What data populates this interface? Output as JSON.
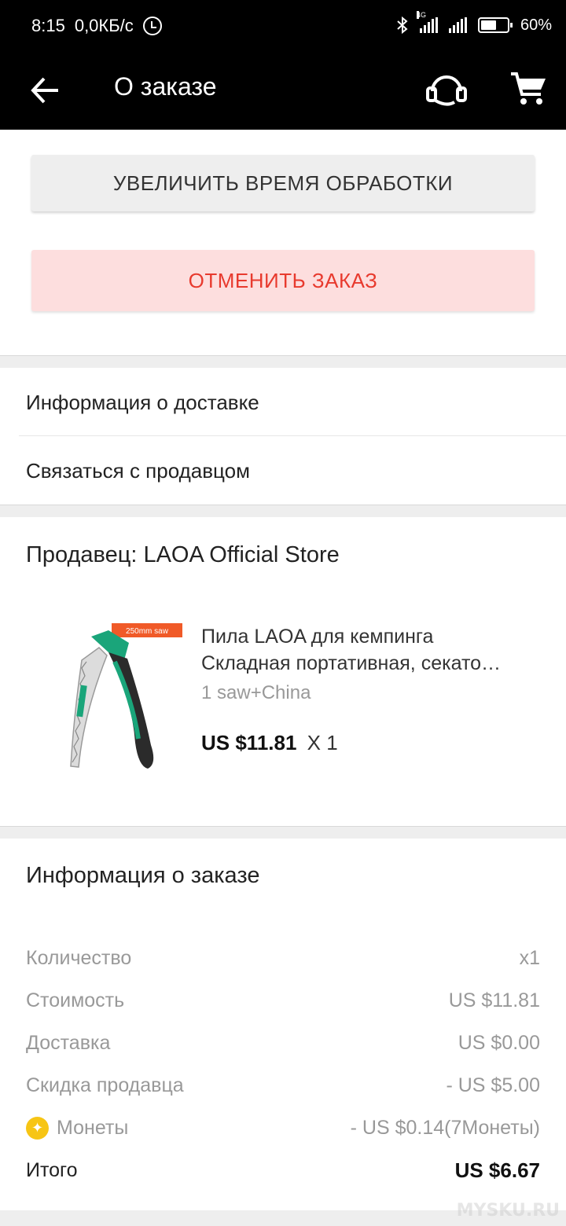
{
  "status_bar": {
    "time": "8:15",
    "speed": "0,0КБ/с",
    "network": "4G",
    "battery": "60%",
    "battery_level": 0.6
  },
  "header": {
    "title": "О заказе"
  },
  "actions": {
    "extend_label": "УВЕЛИЧИТЬ ВРЕМЯ ОБРАБОТКИ",
    "cancel_label": "ОТМЕНИТЬ ЗАКАЗ"
  },
  "menu": {
    "shipping_info": "Информация о доставке",
    "contact_seller": "Связаться с продавцом"
  },
  "seller": {
    "label": "Продавец: LAOA Official Store"
  },
  "product": {
    "badge": "250mm saw",
    "title_line1": "Пила LAOA для кемпинга",
    "title_line2": "Складная портативная, секато…",
    "variant": "1 saw+China",
    "price": "US $11.81",
    "qty": "X 1"
  },
  "order_info": {
    "title": "Информация о заказе",
    "rows": [
      {
        "label": "Количество",
        "value": "x1"
      },
      {
        "label": "Стоимость",
        "value": "US $11.81"
      },
      {
        "label": "Доставка",
        "value": "US $0.00"
      },
      {
        "label": "Скидка продавца",
        "value": "- US $5.00"
      },
      {
        "label": "Монеты",
        "value": "- US $0.14(7Монеты)"
      },
      {
        "label": "Итого",
        "value": "US $6.67"
      }
    ]
  },
  "watermark": "MYSKU.RU",
  "colors": {
    "header_bg": "#000000",
    "cancel_text": "#e83a2e",
    "cancel_bg": "#fddede",
    "coin": "#f7c514",
    "saw_green": "#1aa57a",
    "badge": "#f05a28"
  },
  "icons": {
    "back": "arrow-left-icon",
    "support": "headset-icon",
    "cart": "cart-icon",
    "coin": "coin-icon"
  }
}
